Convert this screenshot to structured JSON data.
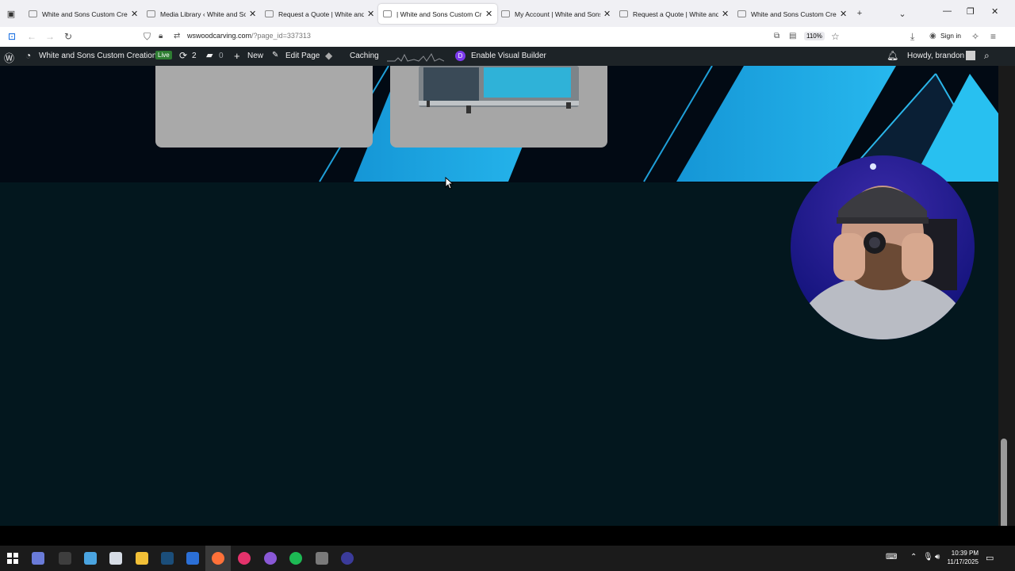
{
  "browser": {
    "tabs": [
      {
        "label": "White and Sons Custom Creatio",
        "active": false
      },
      {
        "label": "Media Library ‹ White and Sons",
        "active": false
      },
      {
        "label": "Request a Quote | White and So",
        "active": false
      },
      {
        "label": "| White and Sons Custom Creati",
        "active": true
      },
      {
        "label": "My Account | White and Sons C",
        "active": false
      },
      {
        "label": "Request a Quote | White and So",
        "active": false
      },
      {
        "label": "White and Sons Custom Creatio",
        "active": false
      }
    ],
    "url_domain": "wswoodcarving.com",
    "url_path": "/?page_id=337313",
    "zoom": "110%",
    "sign_in": "Sign in"
  },
  "wp_admin_bar": {
    "site_name": "White and Sons Custom Creations",
    "live_badge": "Live",
    "updates_count": "2",
    "comments_count": "0",
    "new_label": "New",
    "edit_page_label": "Edit Page",
    "caching_label": "Caching",
    "visual_builder_label": "Enable Visual Builder",
    "divi_letter": "D",
    "greeting": "Howdy, brandon"
  },
  "taskbar": {
    "time": "10:39 PM",
    "date": "11/17/2025"
  },
  "colors": {
    "page_bg": "#03171e",
    "hero_bg": "#020a14",
    "accent_blue": "#1fa4e0",
    "wp_bar": "#1d2327",
    "tab_bar": "#f0f0f4"
  }
}
